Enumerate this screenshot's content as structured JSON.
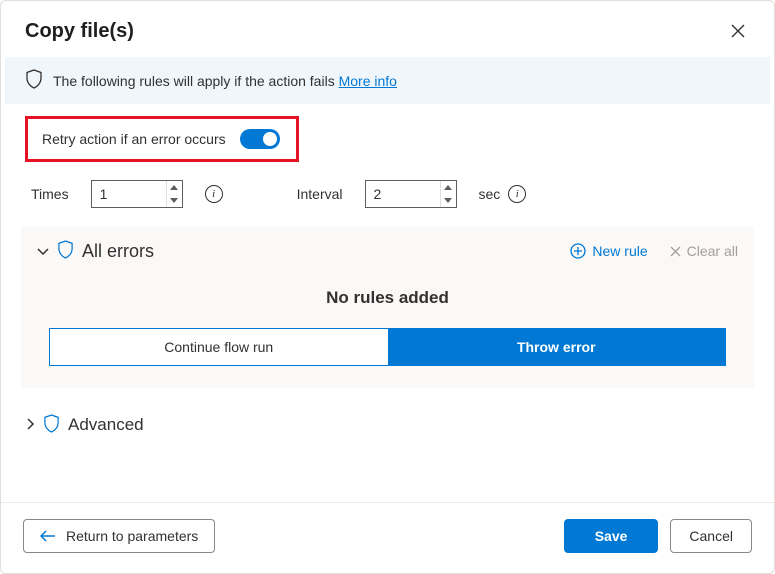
{
  "header": {
    "title": "Copy file(s)"
  },
  "banner": {
    "text": "The following rules will apply if the action fails ",
    "link": "More info"
  },
  "retry": {
    "label": "Retry action if an error occurs",
    "enabled": true
  },
  "times": {
    "label": "Times",
    "value": "1"
  },
  "interval": {
    "label": "Interval",
    "value": "2",
    "unit": "sec"
  },
  "errors_panel": {
    "title": "All errors",
    "new_rule": "New rule",
    "clear_all": "Clear all",
    "empty_text": "No rules added",
    "continue": "Continue flow run",
    "throw": "Throw error"
  },
  "advanced": {
    "title": "Advanced"
  },
  "footer": {
    "return": "Return to parameters",
    "save": "Save",
    "cancel": "Cancel"
  }
}
